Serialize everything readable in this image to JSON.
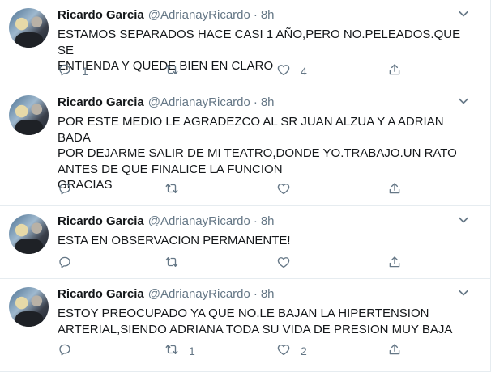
{
  "tweets": [
    {
      "name": "Ricardo Garcia",
      "handle": "@AdrianayRicardo",
      "dot": "·",
      "time": "8h",
      "text": "ESTAMOS SEPARADOS HACE CASI 1 AÑO,PERO NO.PELEADOS.QUE SE\nENTIENDA Y QUEDE BIEN EN CLARO",
      "replies": "1",
      "retweets": "",
      "likes": "4"
    },
    {
      "name": "Ricardo Garcia",
      "handle": "@AdrianayRicardo",
      "dot": "·",
      "time": "8h",
      "text": "POR ESTE MEDIO LE AGRADEZCO AL SR JUAN ALZUA Y A ADRIAN BADA\nPOR DEJARME SALIR DE MI TEATRO,DONDE YO.TRABAJO.UN RATO\nANTES DE QUE FINALICE LA FUNCION\nGRACIAS",
      "replies": "",
      "retweets": "",
      "likes": ""
    },
    {
      "name": "Ricardo Garcia",
      "handle": "@AdrianayRicardo",
      "dot": "·",
      "time": "8h",
      "text": "ESTA EN OBSERVACION PERMANENTE!",
      "replies": "",
      "retweets": "",
      "likes": ""
    },
    {
      "name": "Ricardo Garcia",
      "handle": "@AdrianayRicardo",
      "dot": "·",
      "time": "8h",
      "text": "ESTOY PREOCUPADO YA QUE NO.LE BAJAN LA HIPERTENSION\nARTERIAL,SIENDO ADRIANA TODA SU VIDA DE PRESION MUY BAJA",
      "replies": "",
      "retweets": "1",
      "likes": "2"
    }
  ],
  "icons": {
    "reply": "reply-icon",
    "retweet": "retweet-icon",
    "like": "like-icon",
    "share": "share-icon",
    "caret": "chevron-down-icon"
  },
  "colors": {
    "text": "#14171a",
    "secondary": "#657786",
    "divider": "#e6ecf0"
  }
}
